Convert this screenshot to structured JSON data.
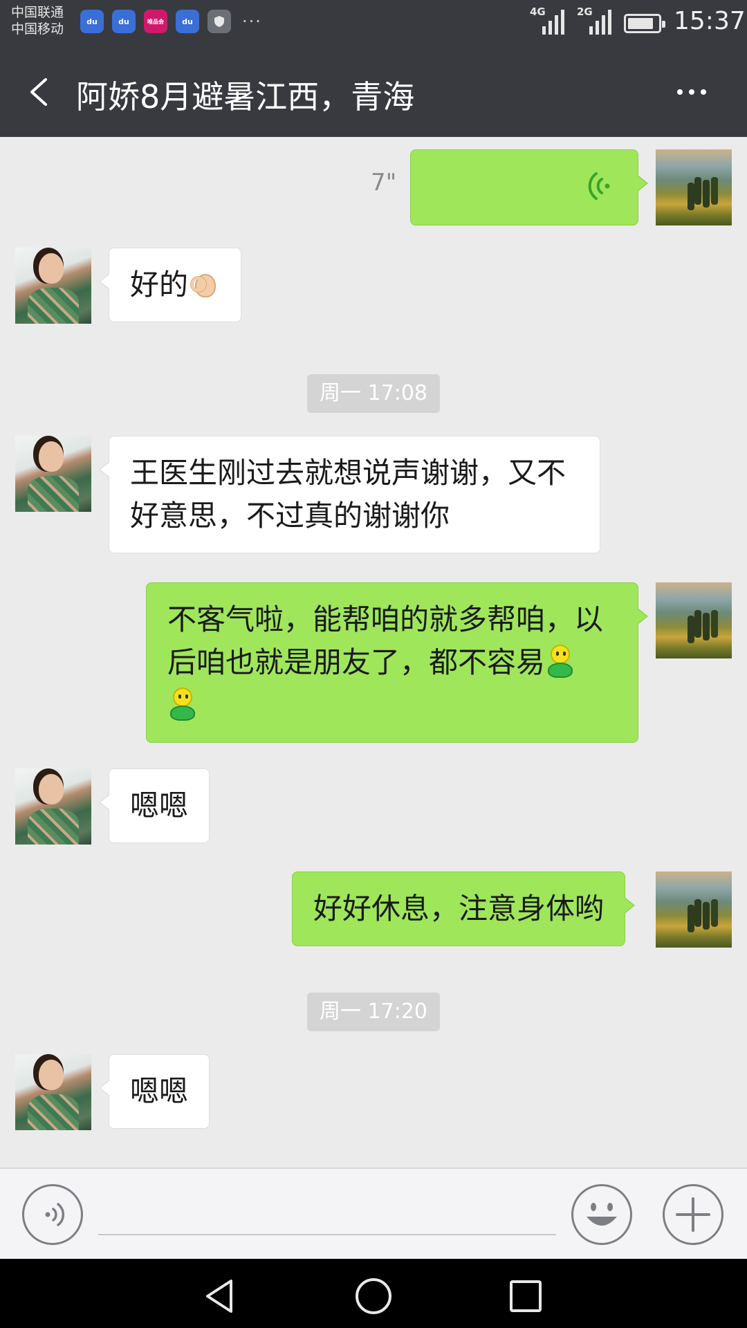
{
  "status_bar": {
    "carrier_1": "中国联通",
    "carrier_2": "中国移动",
    "notification_icons": [
      "baidu-paw-icon",
      "baidu-paw-icon",
      "vipshop-icon",
      "baidu-paw-icon",
      "shield-icon"
    ],
    "icon_texts": [
      "du",
      "du",
      "唯品会",
      "du"
    ],
    "more": "···",
    "network_1": "4G",
    "network_2": "2G",
    "battery_level": 0.85,
    "time": "15:37"
  },
  "header": {
    "title": "阿娇8月避暑江西，青海"
  },
  "messages": [
    {
      "type": "voice",
      "from": "me",
      "duration": "7\""
    },
    {
      "type": "text",
      "from": "her",
      "text": "好的",
      "emoji": "ok-hand-emoji"
    },
    {
      "type": "time",
      "text": "周一 17:08"
    },
    {
      "type": "text",
      "from": "her",
      "lines": [
        "王医生刚过去就想说声谢谢，又不",
        "好意思，不过真的谢谢你"
      ]
    },
    {
      "type": "text",
      "from": "me",
      "lines": [
        "不客气啦，能帮咱的就多帮咱，以",
        "后咱也就是朋友了，都不容易"
      ],
      "emoji": "smiley-guy-emoji"
    },
    {
      "type": "text",
      "from": "her",
      "text": "嗯嗯"
    },
    {
      "type": "text",
      "from": "me",
      "text": "好好休息，注意身体哟"
    },
    {
      "type": "time",
      "text": "周一 17:20"
    },
    {
      "type": "text",
      "from": "her",
      "text": "嗯嗯"
    }
  ],
  "input_bar": {
    "placeholder": "",
    "value": ""
  },
  "colors": {
    "header_bg": "#393a3f",
    "chat_bg": "#ebebeb",
    "my_bubble": "#9fe65b",
    "their_bubble": "#ffffff",
    "voice_icon": "#3aa32a"
  }
}
